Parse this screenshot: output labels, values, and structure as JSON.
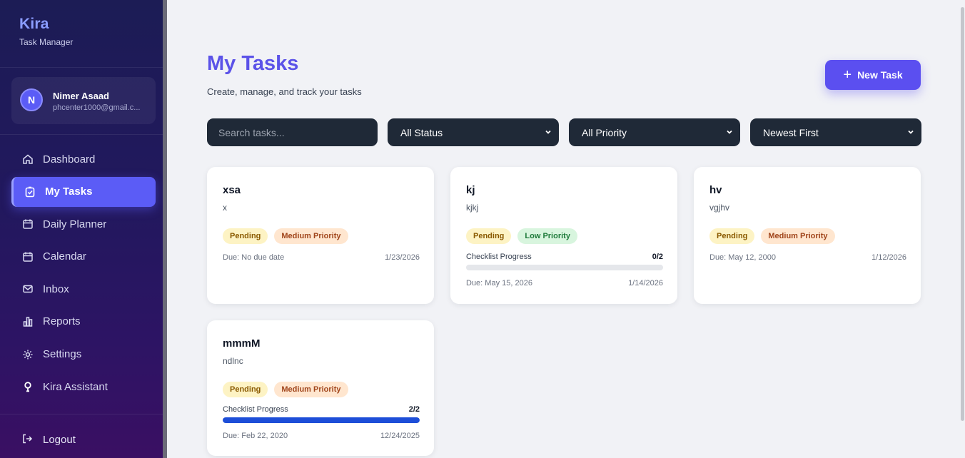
{
  "brand": {
    "name": "Kira",
    "subtitle": "Task Manager"
  },
  "user": {
    "initial": "N",
    "name": "Nimer Asaad",
    "email": "phcenter1000@gmail.c..."
  },
  "nav": {
    "items": [
      {
        "label": "Dashboard",
        "icon": "home-icon",
        "active": false
      },
      {
        "label": "My Tasks",
        "icon": "clipboard-check-icon",
        "active": true
      },
      {
        "label": "Daily Planner",
        "icon": "calendar-icon",
        "active": false
      },
      {
        "label": "Calendar",
        "icon": "calendar-icon",
        "active": false
      },
      {
        "label": "Inbox",
        "icon": "mail-icon",
        "active": false
      },
      {
        "label": "Reports",
        "icon": "bar-chart-icon",
        "active": false
      },
      {
        "label": "Settings",
        "icon": "gear-icon",
        "active": false
      },
      {
        "label": "Kira Assistant",
        "icon": "lightbulb-icon",
        "active": false
      }
    ],
    "logout": "Logout"
  },
  "header": {
    "title": "My Tasks",
    "subtitle": "Create, manage, and track your tasks",
    "new_task_label": "New Task"
  },
  "filters": {
    "search_placeholder": "Search tasks...",
    "status": "All Status",
    "priority": "All Priority",
    "sort": "Newest First"
  },
  "tasks": [
    {
      "title": "xsa",
      "description": "x",
      "status": "Pending",
      "priority": "Medium Priority",
      "priority_level": "medium",
      "checklist": null,
      "due": "Due: No due date",
      "created": "1/23/2026"
    },
    {
      "title": "kj",
      "description": "kjkj",
      "status": "Pending",
      "priority": "Low Priority",
      "priority_level": "low",
      "checklist": {
        "label": "Checklist Progress",
        "count": "0/2",
        "progress": 0
      },
      "due": "Due: May 15, 2026",
      "created": "1/14/2026"
    },
    {
      "title": "hv",
      "description": "vgjhv",
      "status": "Pending",
      "priority": "Medium Priority",
      "priority_level": "medium",
      "checklist": null,
      "due": "Due: May 12, 2000",
      "created": "1/12/2026"
    },
    {
      "title": "mmmM",
      "description": "ndlnc",
      "status": "Pending",
      "priority": "Medium Priority",
      "priority_level": "medium",
      "checklist": {
        "label": "Checklist Progress",
        "count": "2/2",
        "progress": 1
      },
      "due": "Due: Feb 22, 2020",
      "created": "12/24/2025"
    }
  ],
  "colors": {
    "accent": "#5b4ff0",
    "sidebar": "#22185e",
    "progress": "#1d4ed8"
  }
}
